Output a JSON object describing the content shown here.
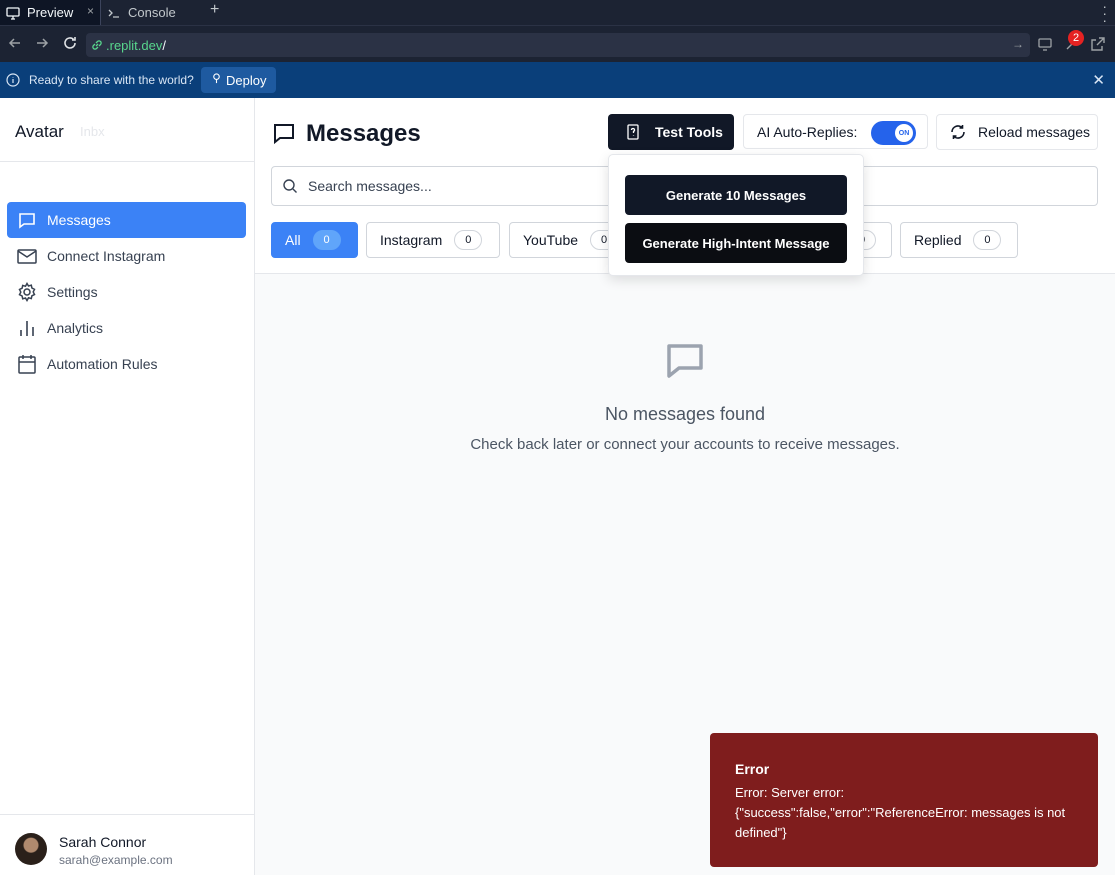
{
  "browser": {
    "tabs": [
      {
        "label": "Preview",
        "close": "×"
      },
      {
        "label": "Console"
      }
    ],
    "new_tab": "+",
    "url_domain": ".replit.dev",
    "url_path": "/",
    "notification_count": "2"
  },
  "deploy_bar": {
    "message": "Ready to share with the world?",
    "deploy_label": "Deploy"
  },
  "sidebar": {
    "logo": "Avatar",
    "logo_ghost": "Inbx",
    "items": [
      {
        "label": "Messages",
        "icon": "message-square-icon",
        "active": true
      },
      {
        "label": "Connect Instagram",
        "icon": "mail-icon"
      },
      {
        "label": "Settings",
        "icon": "gear-icon"
      },
      {
        "label": "Analytics",
        "icon": "bar-chart-icon"
      },
      {
        "label": "Automation Rules",
        "icon": "calendar-icon"
      }
    ],
    "user": {
      "name": "Sarah Connor",
      "email": "sarah@example.com"
    }
  },
  "header": {
    "title": "Messages",
    "test_tools_label": "Test Tools",
    "auto_replies_label": "AI Auto-Replies:",
    "toggle_state": "ON",
    "reload_label": "Reload messages"
  },
  "search": {
    "placeholder": "Search messages..."
  },
  "filters": [
    {
      "label": "All",
      "count": "0",
      "active": true
    },
    {
      "label": "Instagram",
      "count": "0"
    },
    {
      "label": "YouTube",
      "count": "0"
    },
    {
      "label": "",
      "count": "0"
    },
    {
      "label": "Replied",
      "count": "0"
    }
  ],
  "empty_state": {
    "heading": "No messages found",
    "text": "Check back later or connect your accounts to receive messages."
  },
  "dropdown": {
    "items": [
      "Generate 10 Messages",
      "Generate High-Intent Message"
    ]
  },
  "toast": {
    "title": "Error",
    "body": "Error: Server error: {\"success\":false,\"error\":\"ReferenceError: messages is not defined\"}"
  },
  "colors": {
    "accent": "#3b82f6",
    "dark_button": "#111827",
    "error": "#7f1d1d",
    "chrome": "#1c2333",
    "deploy_bar": "#0a3f7a"
  }
}
